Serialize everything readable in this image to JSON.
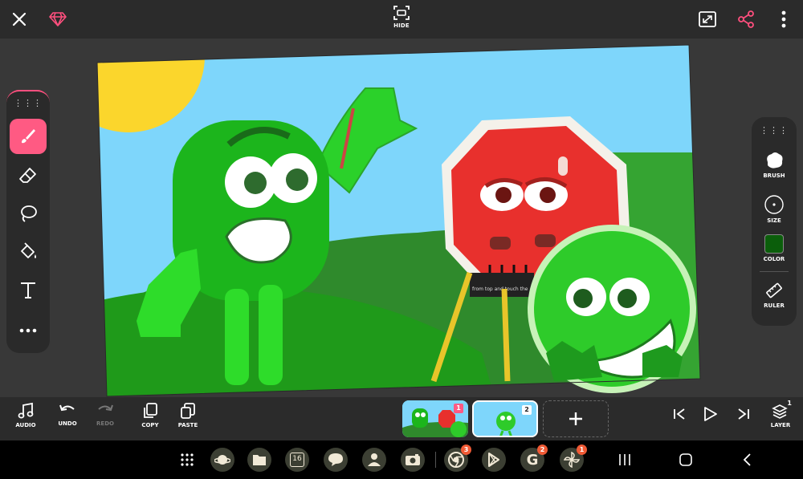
{
  "topbar": {
    "close_icon": "close-icon",
    "premium_icon": "diamond-icon",
    "hide_label": "HIDE",
    "fullscreen_icon": "fullscreen-icon",
    "share_icon": "share-icon",
    "more_icon": "more-vert-icon",
    "accent_color": "#ff4f7e"
  },
  "canvas": {
    "hint_text": "from top and touch the"
  },
  "left_tools": [
    {
      "name": "brush",
      "icon": "brush-icon",
      "active": true
    },
    {
      "name": "eraser",
      "icon": "eraser-icon",
      "active": false
    },
    {
      "name": "lasso",
      "icon": "lasso-icon",
      "active": false
    },
    {
      "name": "fill",
      "icon": "fill-bucket-icon",
      "active": false
    },
    {
      "name": "text",
      "icon": "text-icon",
      "active": false
    },
    {
      "name": "more",
      "icon": "more-horiz-icon",
      "active": false
    }
  ],
  "right_panel": {
    "brush_label": "BRUSH",
    "size_label": "SIZE",
    "color_label": "COLOR",
    "ruler_label": "RULER",
    "current_color": "#0b5e0b"
  },
  "bottombar": {
    "audio_label": "AUDIO",
    "undo_label": "UNDO",
    "redo_label": "REDO",
    "copy_label": "COPY",
    "paste_label": "PASTE",
    "frames": [
      {
        "number": "1",
        "selected": false
      },
      {
        "number": "2",
        "selected": true
      }
    ],
    "add_frame_icon": "plus-icon",
    "layer_label": "LAYER",
    "layer_count": "1"
  },
  "taskbar": {
    "apps": [
      {
        "name": "app-drawer",
        "icon": "grid-icon",
        "badge": ""
      },
      {
        "name": "browser",
        "icon": "planet-icon",
        "badge": ""
      },
      {
        "name": "files",
        "icon": "folder-icon",
        "badge": ""
      },
      {
        "name": "calendar",
        "icon": "calendar-icon",
        "badge": "",
        "text": "16"
      },
      {
        "name": "messages",
        "icon": "chat-icon",
        "badge": ""
      },
      {
        "name": "contacts",
        "icon": "person-icon",
        "badge": ""
      },
      {
        "name": "camera",
        "icon": "camera-icon",
        "badge": ""
      },
      {
        "name": "chrome",
        "icon": "chrome-icon",
        "badge": "3"
      },
      {
        "name": "play-store",
        "icon": "play-store-icon",
        "badge": ""
      },
      {
        "name": "google",
        "icon": "google-icon",
        "badge": "2"
      },
      {
        "name": "pinwheel",
        "icon": "pinwheel-icon",
        "badge": "1"
      }
    ]
  }
}
